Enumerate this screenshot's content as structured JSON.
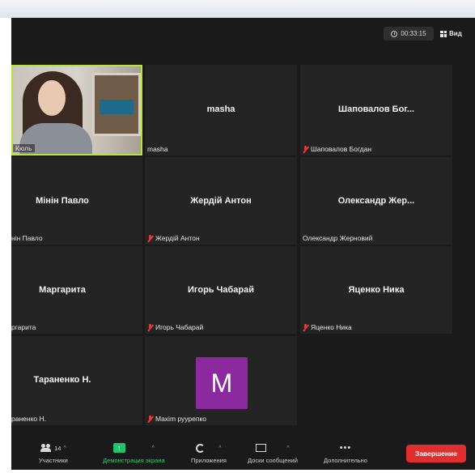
{
  "meeting": {
    "timer": "00:33:15",
    "view_label": "Вид"
  },
  "participants": [
    {
      "id": "p1",
      "center": "",
      "bottom": "Кюль",
      "muted": false,
      "video": true
    },
    {
      "id": "p2",
      "center": "masha",
      "bottom": "masha",
      "muted": false
    },
    {
      "id": "p3",
      "center": "Шаповалов Бог...",
      "bottom": "Шаповалов Богдан",
      "muted": true
    },
    {
      "id": "p4",
      "center": "Мінін Павло",
      "bottom": "нін Павло",
      "muted": false
    },
    {
      "id": "p5",
      "center": "Жердій Антон",
      "bottom": "Жердій Антон",
      "muted": true
    },
    {
      "id": "p6",
      "center": "Олександр Жер...",
      "bottom": "Олександр Жерновий",
      "muted": false
    },
    {
      "id": "p7",
      "center": "Маргарита",
      "bottom": "ргарита",
      "muted": false
    },
    {
      "id": "p8",
      "center": "Игорь Чабарай",
      "bottom": "Игорь Чабарай",
      "muted": true
    },
    {
      "id": "p9",
      "center": "Яценко Ника",
      "bottom": "Яценко Ника",
      "muted": true
    },
    {
      "id": "p10",
      "center": "Тараненко Н.",
      "bottom": "раненко Н.",
      "muted": false
    },
    {
      "id": "p11",
      "avatar_letter": "M",
      "bottom": "Maxim руурепко",
      "muted": true
    }
  ],
  "toolbar": {
    "participants_label": "Участники",
    "participants_count": "14",
    "share_label": "Демонстрация экрана",
    "apps_label": "Приложения",
    "board_label": "Доски сообщений",
    "more_label": "Дополнительно",
    "end_label": "Завершение"
  },
  "colors": {
    "background": "#1a1a1a",
    "tile": "#242424",
    "active_speaker_border": "#b5e53c",
    "avatar": "#8a2a9e",
    "share_green": "#23c16b",
    "end_red": "#e02d2d",
    "muted_red": "#e53935"
  },
  "icons": [
    "clock-icon",
    "grid-view-icon",
    "mic-muted-icon",
    "participants-icon",
    "share-screen-icon",
    "apps-icon",
    "whiteboard-icon",
    "more-icon",
    "chevron-up-icon"
  ]
}
